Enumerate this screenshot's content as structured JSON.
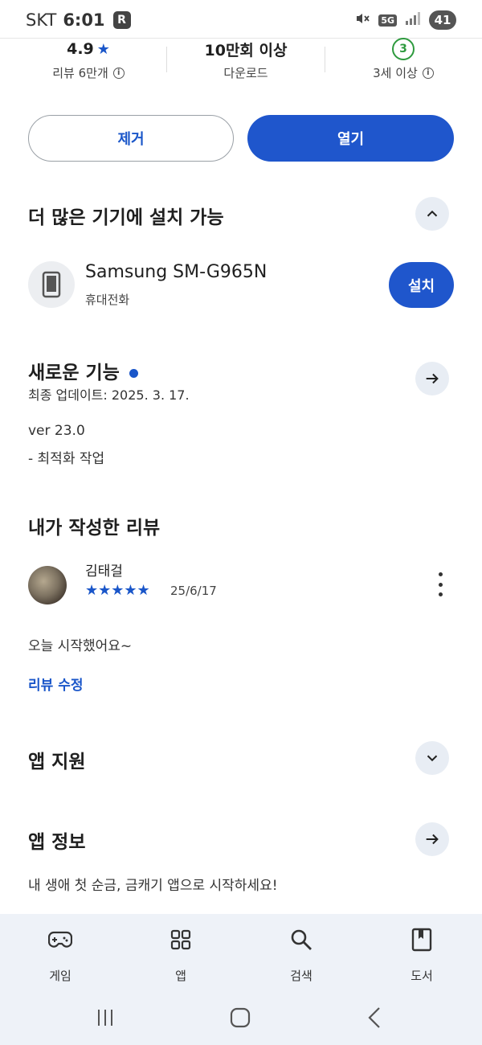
{
  "status_bar": {
    "carrier": "SKT",
    "time": "6:01",
    "app_badge": "R",
    "network": "5G",
    "battery": "41"
  },
  "stats": [
    {
      "value": "4.9",
      "label": "리뷰 6만개"
    },
    {
      "value": "10만회 이상",
      "label": "다운로드"
    },
    {
      "badge": "3",
      "label": "3세 이상"
    }
  ],
  "actions": {
    "remove": "제거",
    "open": "열기"
  },
  "devices_section": {
    "title": "더 많은 기기에 설치 가능",
    "device_name": "Samsung SM-G965N",
    "device_type": "휴대전화",
    "install": "설치"
  },
  "whats_new": {
    "title": "새로운 기능",
    "updated": "최종 업데이트: 2025. 3. 17.",
    "version": "ver 23.0",
    "note": "- 최적화 작업"
  },
  "my_review": {
    "title": "내가 작성한 리뷰",
    "author": "김태걸",
    "rating": 5,
    "stars": "★★★★★",
    "date": "25/6/17",
    "text": "오늘 시작했어요~",
    "edit": "리뷰 수정"
  },
  "app_support": {
    "title": "앱 지원"
  },
  "app_info": {
    "title": "앱 정보",
    "description": "내 생애 첫 순금, 금캐기 앱으로 시작하세요!"
  },
  "bottom_nav": {
    "games": "게임",
    "apps": "앱",
    "search": "검색",
    "books": "도서"
  },
  "colors": {
    "accent": "#1f56cc",
    "nav_bg": "#eef2f8",
    "age_badge": "#2e9a3e"
  }
}
